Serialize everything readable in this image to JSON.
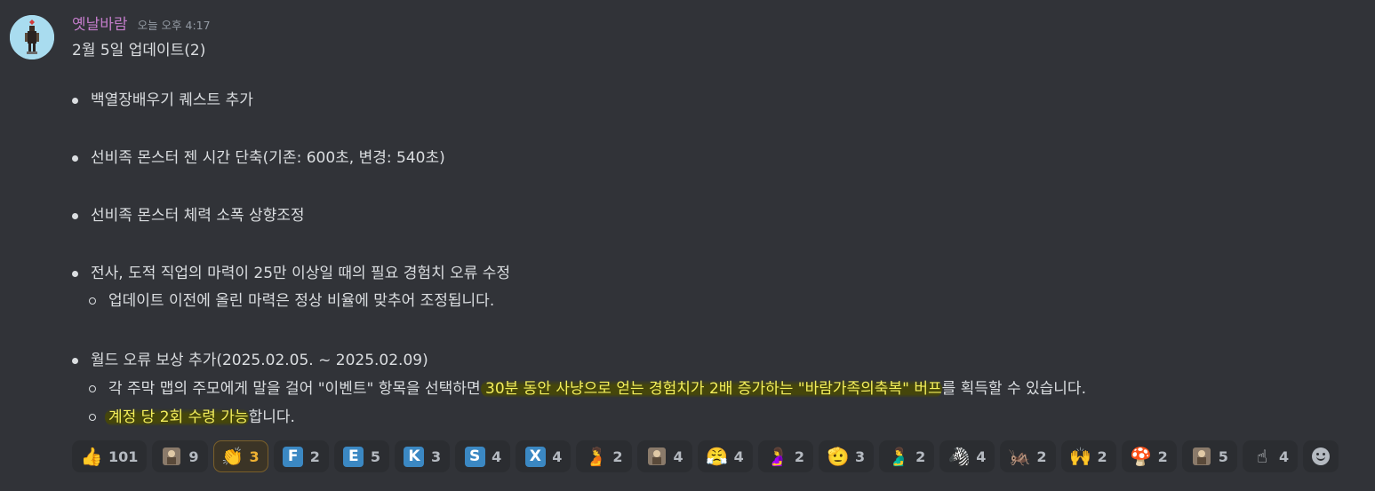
{
  "message": {
    "username": "옛날바람",
    "timestamp": "오늘 오후 4:17",
    "title": "2월 5일 업데이트(2)",
    "items": [
      {
        "text": "백열장배우기 퀘스트 추가"
      },
      {
        "text": "선비족 몬스터 젠 시간 단축(기존: 600초, 변경: 540초)"
      },
      {
        "text": "선비족 몬스터 체력 소폭 상향조정"
      },
      {
        "text": "전사, 도적 직업의 마력이 25만 이상일 때의 필요 경험치 오류 수정",
        "sub": [
          "업데이트 이전에 올린 마력은 정상 비율에 맞추어 조정됩니다."
        ]
      },
      {
        "text": "월드 오류 보상 추가(2025.02.05. ~ 2025.02.09)",
        "sub1_a": "각 주막 맵의 주모에게 말을 걸어 \"이벤트\" 항목을 선택하면",
        "sub1_hl": " 30분 동안 사냥으로 얻는 경험치가 2배 증가하는 \"바람가족의축복\" 버프",
        "sub1_b": "를 획득할 수 있습니다.",
        "sub2_hl": "계정 당 2회 수령 가능",
        "sub2_b": "합니다."
      }
    ]
  },
  "reactions": [
    {
      "icon": "thumbs-up-icon",
      "glyph": "👍",
      "count": "101"
    },
    {
      "icon": "custom-character-icon",
      "glyph": "",
      "count": "9"
    },
    {
      "icon": "clapping-hands-icon",
      "glyph": "👏",
      "count": "3",
      "active": true
    },
    {
      "icon": "regional-f-icon",
      "letter": "F",
      "count": "2"
    },
    {
      "icon": "regional-e-icon",
      "letter": "E",
      "count": "5"
    },
    {
      "icon": "regional-k-icon",
      "letter": "K",
      "count": "3"
    },
    {
      "icon": "regional-s-icon",
      "letter": "S",
      "count": "4"
    },
    {
      "icon": "regional-x-icon",
      "letter": "X",
      "count": "4"
    },
    {
      "icon": "pregnant-person-icon",
      "glyph": "🫄",
      "count": "2"
    },
    {
      "icon": "custom-figure-icon",
      "glyph": "",
      "count": "4"
    },
    {
      "icon": "face-with-steam-icon",
      "glyph": "😤",
      "count": "4"
    },
    {
      "icon": "pregnant-woman-icon",
      "glyph": "🤰",
      "count": "2"
    },
    {
      "icon": "saluting-face-icon",
      "glyph": "🫡",
      "count": "3"
    },
    {
      "icon": "pregnant-man-icon",
      "glyph": "🫃",
      "count": "2"
    },
    {
      "icon": "zebra-icon",
      "glyph": "🦓",
      "count": "4"
    },
    {
      "icon": "cricket-icon",
      "glyph": "🦗",
      "count": "2"
    },
    {
      "icon": "raising-hands-icon",
      "glyph": "🙌",
      "count": "2"
    },
    {
      "icon": "mushroom-icon",
      "glyph": "🍄",
      "count": "2"
    },
    {
      "icon": "custom-face-icon",
      "glyph": "",
      "count": "5"
    },
    {
      "icon": "index-pointing-up-icon",
      "glyph": "☝",
      "count": "4"
    }
  ],
  "colors": {
    "background": "#313338",
    "username": "#c27cc9",
    "highlight_text": "#f3ee5b",
    "active_count": "#f0b232",
    "regional_box": "#3b88c3"
  }
}
